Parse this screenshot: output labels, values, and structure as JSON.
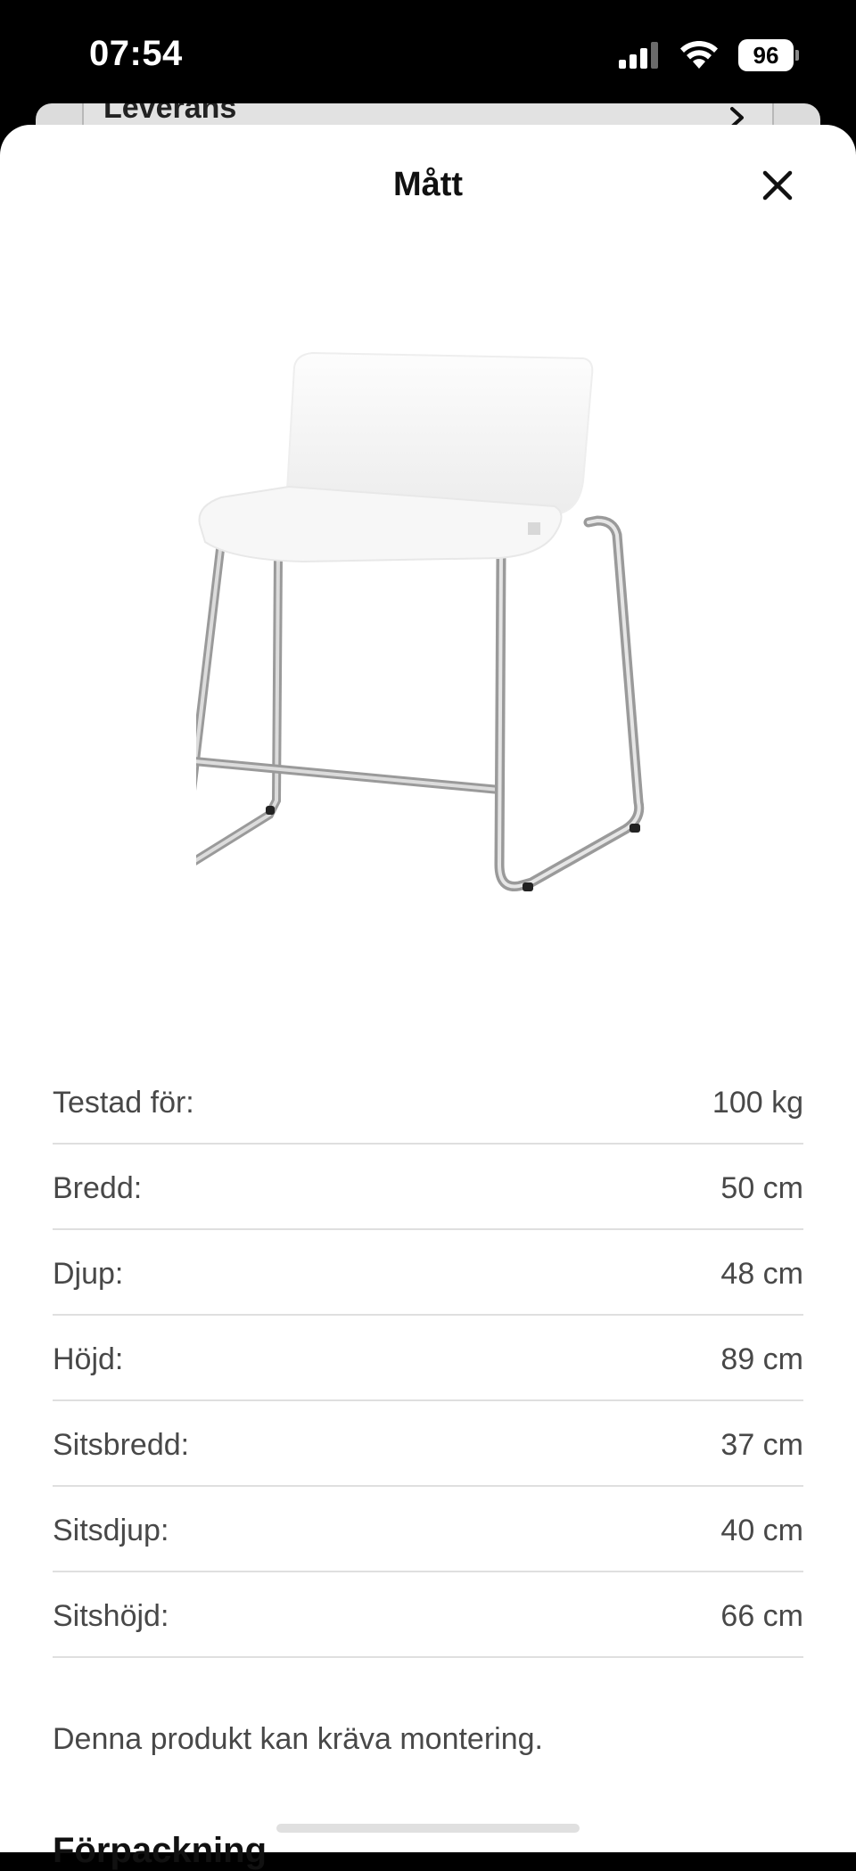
{
  "status_bar": {
    "time": "07:54",
    "battery": "96",
    "signal_icon": "cellular-signal-icon",
    "wifi_icon": "wifi-icon"
  },
  "background_card": {
    "label": "Leverans",
    "chevron_icon": "chevron-right-icon"
  },
  "sheet": {
    "title": "Mått",
    "close_icon": "close-icon"
  },
  "product_image": {
    "icon": "bar-stool-image"
  },
  "dimensions": [
    {
      "label": "Testad för:",
      "value": "100 kg"
    },
    {
      "label": "Bredd:",
      "value": "50 cm"
    },
    {
      "label": "Djup:",
      "value": "48 cm"
    },
    {
      "label": "Höjd:",
      "value": "89 cm"
    },
    {
      "label": "Sitsbredd:",
      "value": "37 cm"
    },
    {
      "label": "Sitsdjup:",
      "value": "40 cm"
    },
    {
      "label": "Sitshöjd:",
      "value": "66 cm"
    }
  ],
  "assembly_note": "Denna produkt kan kräva montering.",
  "next_section_heading": "Förpackning"
}
